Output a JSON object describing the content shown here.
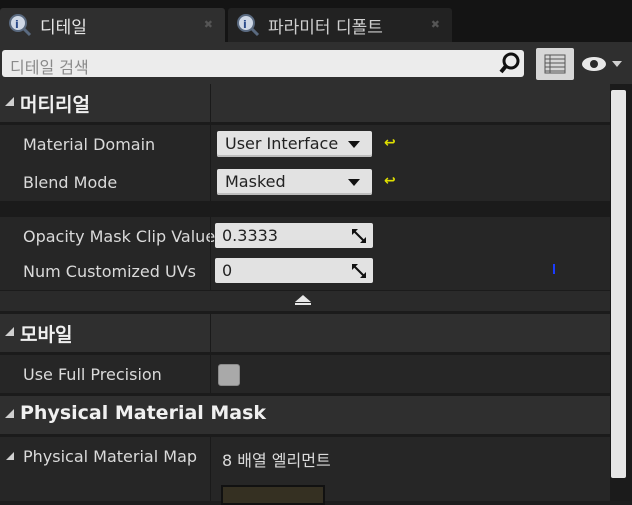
{
  "tabs": [
    {
      "label": "디테일",
      "icon": "details-magnifier-icon",
      "active": true
    },
    {
      "label": "파라미터 디폴트",
      "icon": "details-magnifier-icon",
      "active": false
    }
  ],
  "search": {
    "placeholder": "디테일 검색"
  },
  "categories": {
    "material": {
      "label": "머티리얼",
      "rows": [
        {
          "name": "Material Domain",
          "value": "User Interface"
        },
        {
          "name": "Blend Mode",
          "value": "Masked"
        }
      ],
      "advanced": [
        {
          "name": "Opacity Mask Clip Value",
          "value": "0.3333"
        },
        {
          "name": "Num Customized UVs",
          "value": "0"
        }
      ]
    },
    "mobile": {
      "label": "모바일",
      "rows": [
        {
          "name": "Use Full Precision",
          "checked": false
        }
      ]
    },
    "physmask": {
      "label": "Physical Material Mask",
      "rows": [
        {
          "name": "Physical Material Map",
          "value": "8 배열 엘리먼트"
        }
      ]
    }
  },
  "colors": {
    "accent_reset": "#e0e000",
    "bg": "#1d1d1d",
    "row": "#262626",
    "category": "#2f2f2f"
  }
}
